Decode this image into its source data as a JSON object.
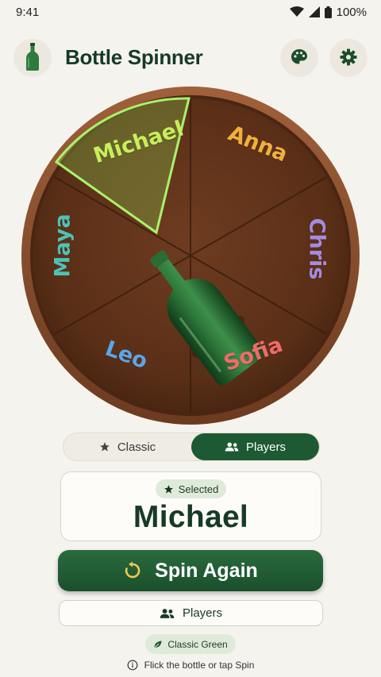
{
  "status": {
    "time": "9:41",
    "battery": "100%"
  },
  "app": {
    "title": "Bottle Spinner"
  },
  "icons": {
    "logo": "bottle-icon",
    "theme": "palette-icon",
    "settings": "gear-icon"
  },
  "wheel": {
    "players": [
      {
        "name": "Michael",
        "color": "#c6ef5a"
      },
      {
        "name": "Anna",
        "color": "#f0b13c"
      },
      {
        "name": "Chris",
        "color": "#a58be0"
      },
      {
        "name": "Sofia",
        "color": "#f06a6a"
      },
      {
        "name": "Leo",
        "color": "#5aa6e6"
      },
      {
        "name": "Maya",
        "color": "#4fc1b5"
      }
    ],
    "highlight_color": "#8fe25a"
  },
  "mode": {
    "classic_label": "Classic",
    "players_label": "Players",
    "active": "Players"
  },
  "selected": {
    "badge_label": "Selected",
    "name": "Michael"
  },
  "spin_button": {
    "label": "Spin Again"
  },
  "players_button": {
    "label": "Players"
  },
  "theme": {
    "label": "Classic Green"
  },
  "hint": {
    "text": "Flick the bottle or tap Spin"
  },
  "colors": {
    "brand": "#1d5a33",
    "background": "#f5f3ee",
    "wood": "#6b3a1f"
  }
}
